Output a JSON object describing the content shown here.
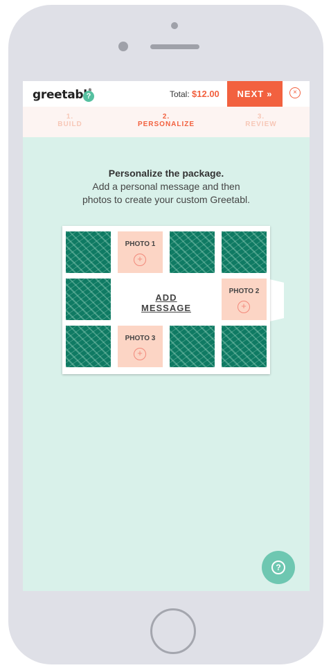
{
  "header": {
    "logo": "greetabl",
    "logo_mark": "®",
    "help_icon": "?",
    "total_label": "Total: ",
    "total_price": "$12.00",
    "next_label": "NEXT",
    "next_icon": "»",
    "close_icon": "×"
  },
  "steps": [
    {
      "number": "1.",
      "label": "BUILD"
    },
    {
      "number": "2.",
      "label": "PERSONALIZE"
    },
    {
      "number": "3.",
      "label": "REVIEW"
    }
  ],
  "intro": {
    "heading": "Personalize the package.",
    "line1": "Add a personal message and then",
    "line2": "photos to create your custom Greetabl."
  },
  "grid": {
    "photo1": "PHOTO 1",
    "photo2": "PHOTO 2",
    "photo3": "PHOTO 3",
    "plus_icon": "+",
    "add_message": "ADD MESSAGE"
  },
  "help_fab_icon": "?",
  "colors": {
    "accent": "#f2613f",
    "screen_bg": "#d9f1ea",
    "pattern_green": "#0f7a63",
    "photo_slot": "#fcd5c5",
    "help_fab": "#6ec7b1"
  }
}
